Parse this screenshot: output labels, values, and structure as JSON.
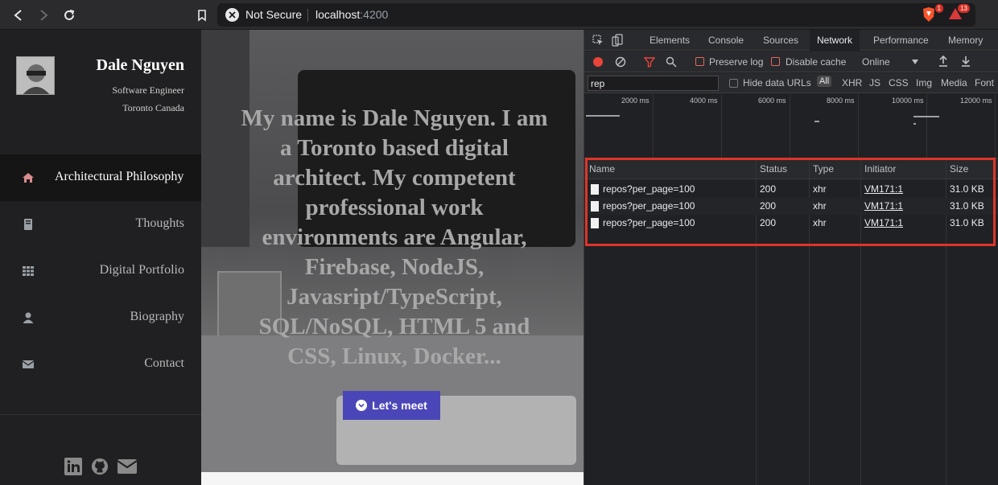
{
  "browser": {
    "security_label": "Not Secure",
    "url_host": "localhost",
    "url_port": ":4200",
    "extensions": [
      {
        "icon": "brave-shield-icon",
        "badge": "1"
      },
      {
        "icon": "brave-rewards-icon",
        "badge": "13"
      }
    ]
  },
  "sidebar": {
    "name": "Dale Nguyen",
    "title": "Software Engineer",
    "location": "Toronto Canada",
    "nav": [
      {
        "icon": "home-icon",
        "label": "Architectural Philosophy",
        "active": true
      },
      {
        "icon": "book-icon",
        "label": "Thoughts"
      },
      {
        "icon": "grid-icon",
        "label": "Digital Portfolio"
      },
      {
        "icon": "user-icon",
        "label": "Biography"
      },
      {
        "icon": "envelope-icon",
        "label": "Contact"
      }
    ],
    "social": [
      "linkedin-icon",
      "github-icon",
      "mail-icon"
    ]
  },
  "hero": {
    "text": "My name is Dale Nguyen. I am a Toronto based digital architect. My competent professional work environments are Angular, Firebase, NodeJS, Javasript/TypeScript, SQL/NoSQL, HTML 5 and CSS, Linux, Docker...",
    "button_label": "Let's meet"
  },
  "devtools": {
    "tabs": [
      "Elements",
      "Console",
      "Sources",
      "Network",
      "Performance",
      "Memory"
    ],
    "active_tab": "Network",
    "preserve_log": "Preserve log",
    "disable_cache": "Disable cache",
    "throttle": "Online",
    "filter_value": "rep",
    "hide_data_urls": "Hide data URLs",
    "type_filters": [
      "All",
      "XHR",
      "JS",
      "CSS",
      "Img",
      "Media",
      "Font"
    ],
    "timeline_labels": [
      "2000 ms",
      "4000 ms",
      "6000 ms",
      "8000 ms",
      "10000 ms",
      "12000 ms"
    ],
    "columns": [
      "Name",
      "Status",
      "Type",
      "Initiator",
      "Size"
    ],
    "rows": [
      {
        "name": "repos?per_page=100",
        "status": "200",
        "type": "xhr",
        "initiator": "VM171:1",
        "size": "31.0 KB"
      },
      {
        "name": "repos?per_page=100",
        "status": "200",
        "type": "xhr",
        "initiator": "VM171:1",
        "size": "31.0 KB"
      },
      {
        "name": "repos?per_page=100",
        "status": "200",
        "type": "xhr",
        "initiator": "VM171:1",
        "size": "31.0 KB"
      }
    ]
  }
}
